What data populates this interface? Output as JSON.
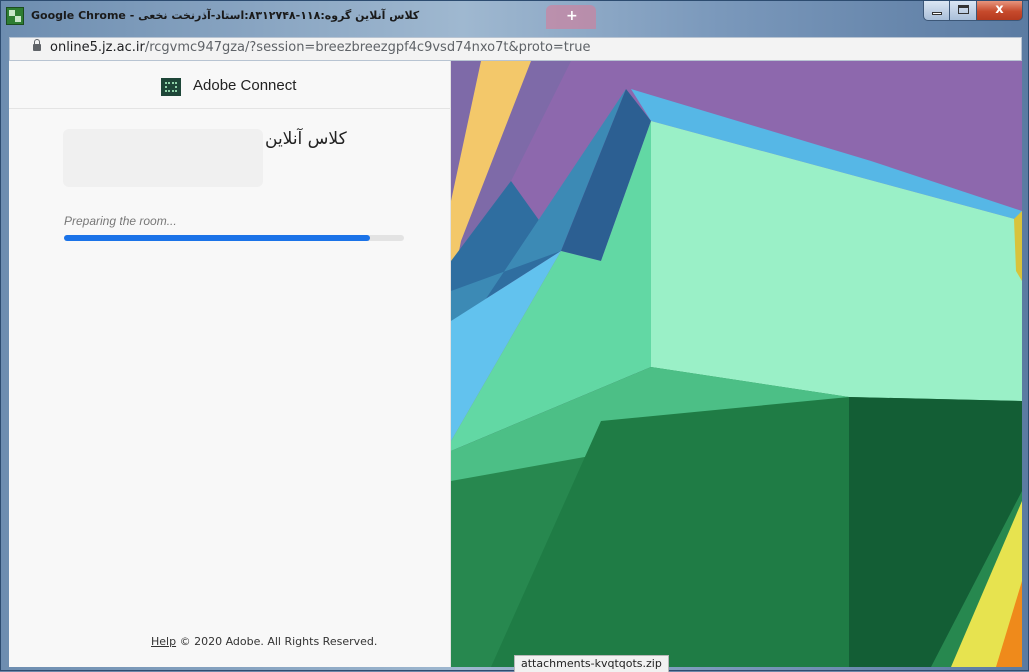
{
  "window": {
    "title": "Google Chrome - کلاس آنلاین گروه:۱۱۸-۸۳۱۲۷۴۸:استاد-آذرنخت نخعی",
    "tab_glyph": "+",
    "close_glyph": "x"
  },
  "address_bar": {
    "host": "online5.jz.ac.ir",
    "path": "/rcgvmc947gza/?session=breezbreezgpf4c9vsd74nxo7t&proto=true"
  },
  "brand": {
    "name": "Adobe Connect"
  },
  "room": {
    "title": "کلاس آنلاین",
    "status": "Preparing the room...",
    "progress_fraction": 0.9
  },
  "footer": {
    "help_link": "Help",
    "copyright": "© 2020 Adobe. All Rights Reserved."
  },
  "status_bar": {
    "download": "attachments-kvqtqots.zip"
  },
  "colors": {
    "progress": "#1b73e8",
    "brand_logo": "#1e4638",
    "close_button": "#c64a2c"
  }
}
